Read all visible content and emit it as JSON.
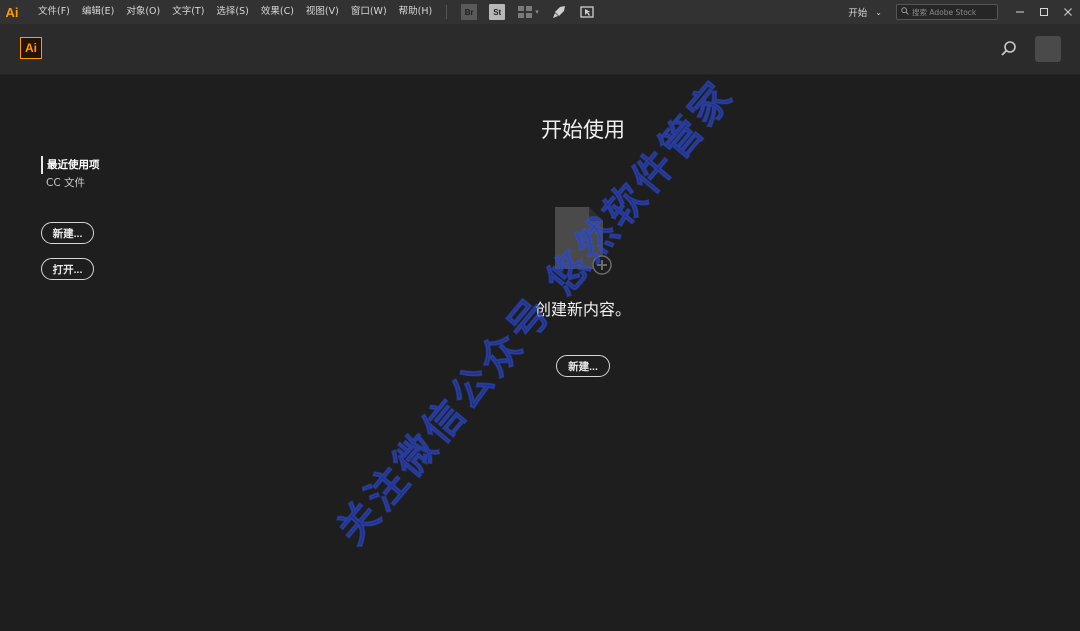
{
  "menubar": {
    "app_badge": "Ai",
    "menus": [
      "文件(F)",
      "编辑(E)",
      "对象(O)",
      "文字(T)",
      "选择(S)",
      "效果(C)",
      "视图(V)",
      "窗口(W)",
      "帮助(H)"
    ],
    "tools": {
      "br_label": "Br",
      "st_label": "St"
    },
    "workspace_label": "开始",
    "stock_search_placeholder": "搜索 Adobe Stock"
  },
  "homebar": {
    "logo_label": "Ai"
  },
  "sidebar": {
    "links": [
      "最近使用项",
      "CC 文件"
    ],
    "new_button": "新建...",
    "open_button": "打开..."
  },
  "main": {
    "title": "开始使用",
    "create_text": "创建新内容。",
    "new_button": "新建..."
  },
  "watermark": {
    "text": "关注微信公众号  悠然软件管家"
  },
  "colors": {
    "accent": "#ff9a00",
    "background": "#1e1e1e",
    "menubar": "#323232",
    "homebar": "#2b2b2b"
  }
}
